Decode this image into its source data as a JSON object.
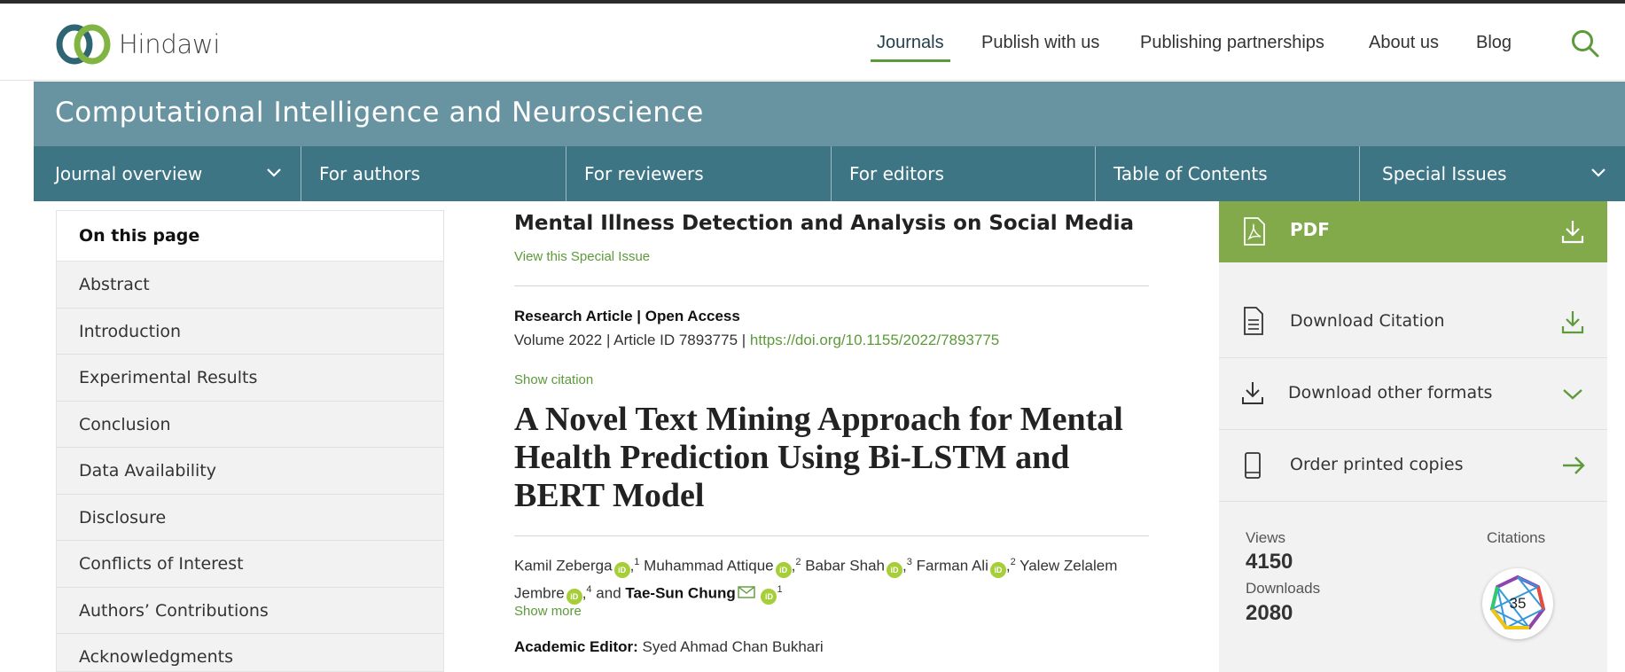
{
  "header": {
    "logo_text": "Hindawi",
    "nav": [
      "Journals",
      "Publish with us",
      "Publishing partnerships",
      "About us",
      "Blog"
    ],
    "active_nav": "Journals",
    "search_icon": "search-icon"
  },
  "journal": {
    "title": "Computational Intelligence and Neuroscience",
    "nav": [
      "Journal overview",
      "For authors",
      "For reviewers",
      "For editors",
      "Table of Contents",
      "Special Issues"
    ]
  },
  "sidebar": {
    "heading": "On this page",
    "items": [
      "Abstract",
      "Introduction",
      "Experimental Results",
      "Conclusion",
      "Data Availability",
      "Disclosure",
      "Conflicts of Interest",
      "Authors’ Contributions",
      "Acknowledgments"
    ]
  },
  "article": {
    "special_issue": "Mental Illness Detection and Analysis on Social Media",
    "view_special_issue": "View this Special Issue",
    "type": "Research Article | Open Access",
    "volume_text": "Volume 2022 | Article ID 7893775 | ",
    "doi": "https://doi.org/10.1155/2022/7893775",
    "show_citation": "Show citation",
    "title": "A Novel Text Mining Approach for Mental Health Prediction Using Bi-LSTM and BERT Model",
    "authors": {
      "a1": "Kamil Zeberga",
      "a1_sup": "1",
      "a2": "Muhammad Attique",
      "a2_sup": "2",
      "a3": "Babar Shah",
      "a3_sup": "3",
      "a4": "Farman Ali",
      "a4_sup": "2",
      "a5": "Yalew Zelalem Jembre",
      "a5_sup": "4",
      "and": "and",
      "a6": "Tae-Sun Chung",
      "a6_sup": "1"
    },
    "show_more": "Show more",
    "editor_label": "Academic Editor:",
    "editor_name": "Syed Ahmad Chan Bukhari"
  },
  "right_panel": {
    "pdf_label": "PDF",
    "download_citation": "Download Citation",
    "download_other": "Download other formats",
    "order_printed": "Order printed copies",
    "views_label": "Views",
    "views": "4150",
    "downloads_label": "Downloads",
    "downloads": "2080",
    "citations_label": "Citations",
    "citations": "35"
  },
  "colors": {
    "accent_green": "#5c9a3a",
    "pdf_green": "#82a94a",
    "journal_band": "#6894a2",
    "journal_nav": "#3e7585",
    "orcid": "#a6ce39"
  }
}
